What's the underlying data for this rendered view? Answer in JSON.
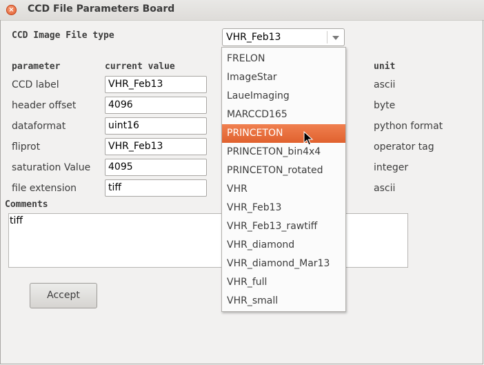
{
  "window": {
    "title": "CCD File Parameters Board",
    "close_glyph": "×"
  },
  "file_type": {
    "label": "CCD Image File type",
    "selected": "VHR_Feb13",
    "options": [
      "FRELON",
      "ImageStar",
      "LaueImaging",
      "MARCCD165",
      "PRINCETON",
      "PRINCETON_bin4x4",
      "PRINCETON_rotated",
      "VHR",
      "VHR_Feb13",
      "VHR_Feb13_rawtiff",
      "VHR_diamond",
      "VHR_diamond_Mar13",
      "VHR_full",
      "VHR_small"
    ],
    "highlighted": "PRINCETON"
  },
  "columns": {
    "parameter": "parameter",
    "current_value": "current value",
    "unit": "unit"
  },
  "params": [
    {
      "name": "CCD label",
      "value": "VHR_Feb13",
      "unit": "ascii"
    },
    {
      "name": "header offset",
      "value": "4096",
      "unit": "byte"
    },
    {
      "name": "dataformat",
      "value": "uint16",
      "unit": "python format"
    },
    {
      "name": "fliprot",
      "value": "VHR_Feb13",
      "unit": "operator tag"
    },
    {
      "name": "saturation Value",
      "value": "4095",
      "unit": "integer"
    },
    {
      "name": "file extension",
      "value": "tiff",
      "unit": "ascii"
    }
  ],
  "comments": {
    "label": "Comments",
    "text": "tiff"
  },
  "buttons": {
    "accept": "Accept"
  },
  "colors": {
    "highlight": "#e9703f",
    "window_bg": "#f2f1f0"
  }
}
